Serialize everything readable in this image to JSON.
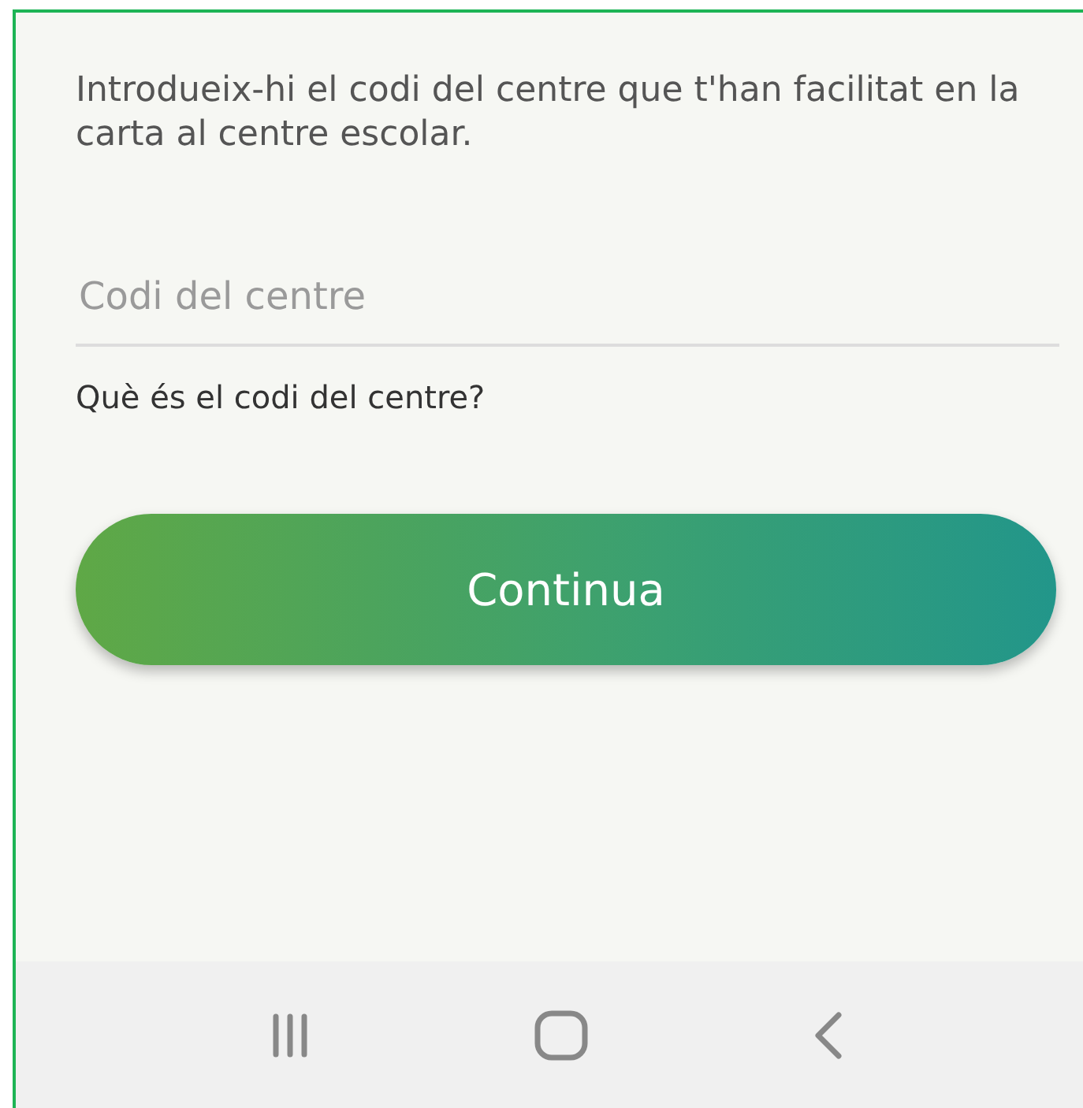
{
  "instruction": "Introdueix-hi el codi del centre que t'han facilitat en la carta al centre escolar.",
  "code_field": {
    "placeholder": "Codi del centre"
  },
  "help_link": "Què és el codi del centre?",
  "continue_button": "Continua"
}
